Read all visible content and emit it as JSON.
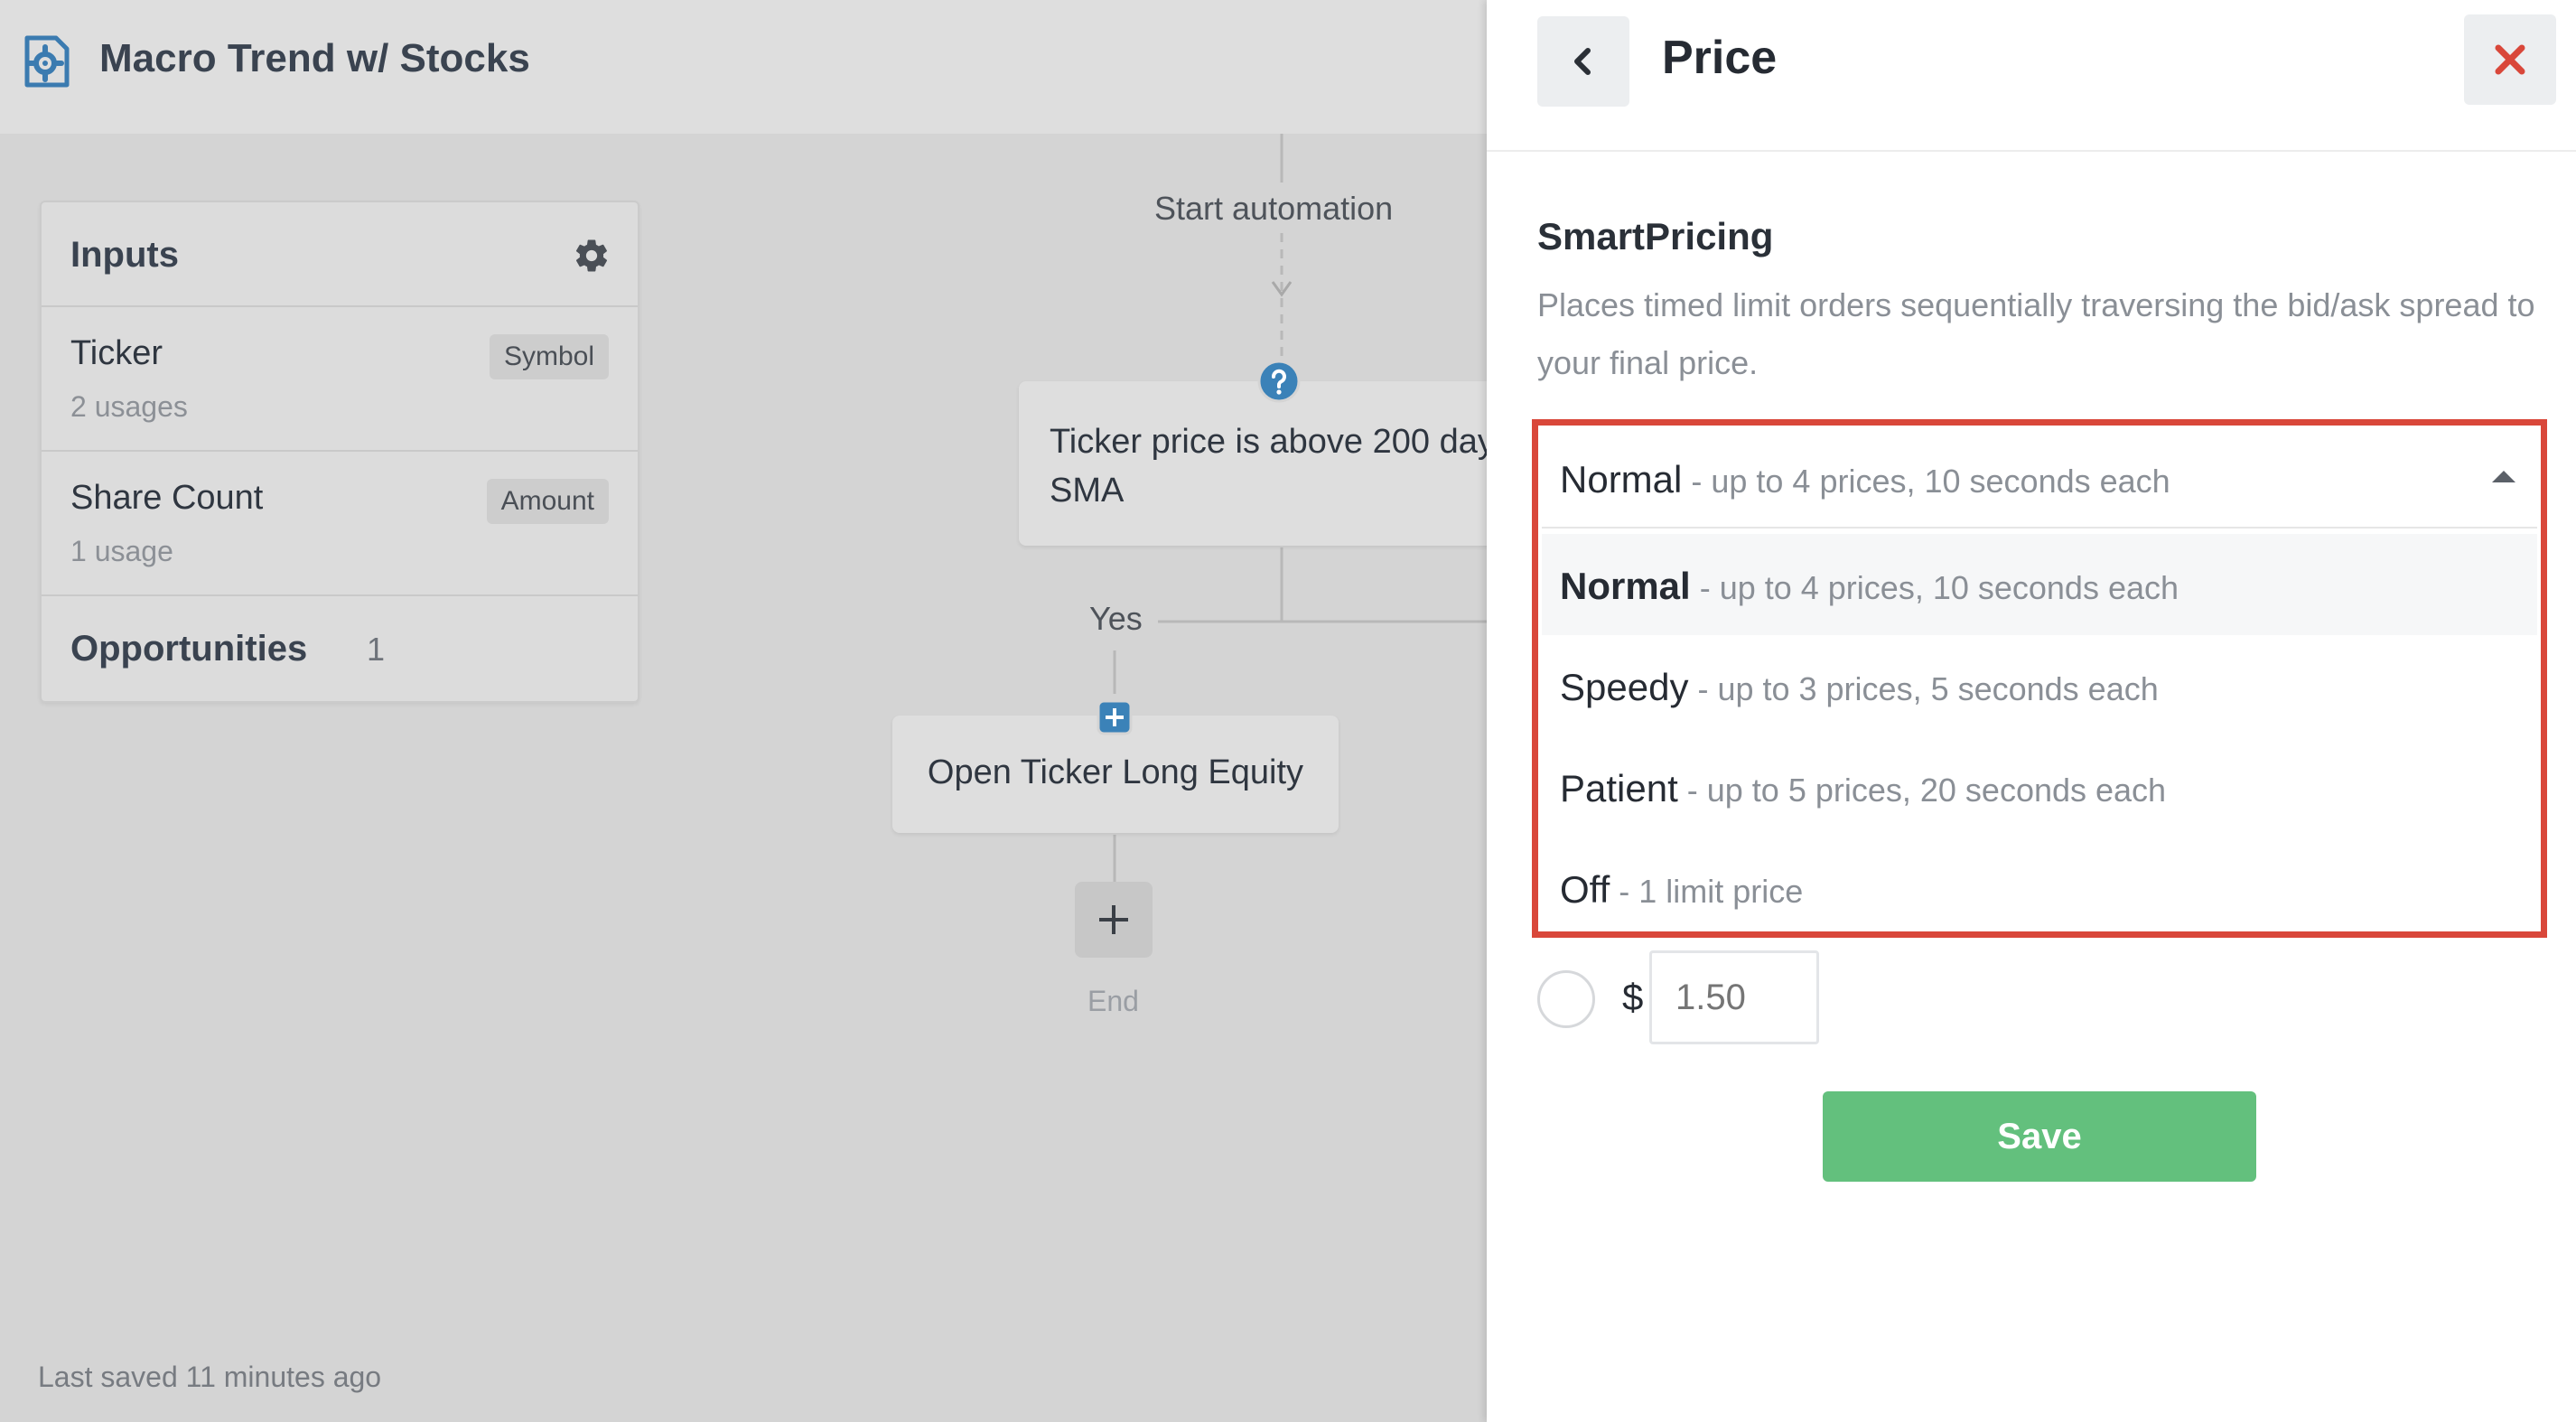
{
  "app": {
    "title": "Macro Trend w/ Stocks"
  },
  "inputs": {
    "title": "Inputs",
    "items": [
      {
        "name": "Ticker",
        "usage": "2 usages",
        "badge": "Symbol"
      },
      {
        "name": "Share Count",
        "usage": "1 usage",
        "badge": "Amount"
      }
    ],
    "opportunities": {
      "label": "Opportunities",
      "count": "1"
    }
  },
  "flow": {
    "start_label": "Start automation",
    "condition_text": "Ticker price is above 200 day\nSMA",
    "yes_label": "Yes",
    "action_text": "Open Ticker Long Equity",
    "end_label": "End"
  },
  "footer": {
    "last_saved": "Last saved 11 minutes ago"
  },
  "panel": {
    "title": "Price",
    "smart_pricing": {
      "title": "SmartPricing",
      "description": "Places timed limit orders sequentially traversing the bid/ask spread to your final price."
    },
    "dropdown": {
      "selected": {
        "name": "Normal",
        "desc": " - up to 4 prices, 10 seconds each"
      },
      "options": [
        {
          "name": "Normal",
          "desc": " - up to 4 prices, 10 seconds each"
        },
        {
          "name": "Speedy",
          "desc": " - up to 3 prices, 5 seconds each"
        },
        {
          "name": "Patient",
          "desc": " - up to 5 prices, 20 seconds each"
        },
        {
          "name": "Off",
          "desc": " - 1 limit price"
        }
      ]
    },
    "price": {
      "currency": "$",
      "placeholder": "1.50"
    },
    "save_label": "Save"
  },
  "colors": {
    "highlight_border": "#d9473a",
    "save_green": "#63c07d",
    "close_red": "#d9473a",
    "flow_blue": "#3b82b8"
  }
}
